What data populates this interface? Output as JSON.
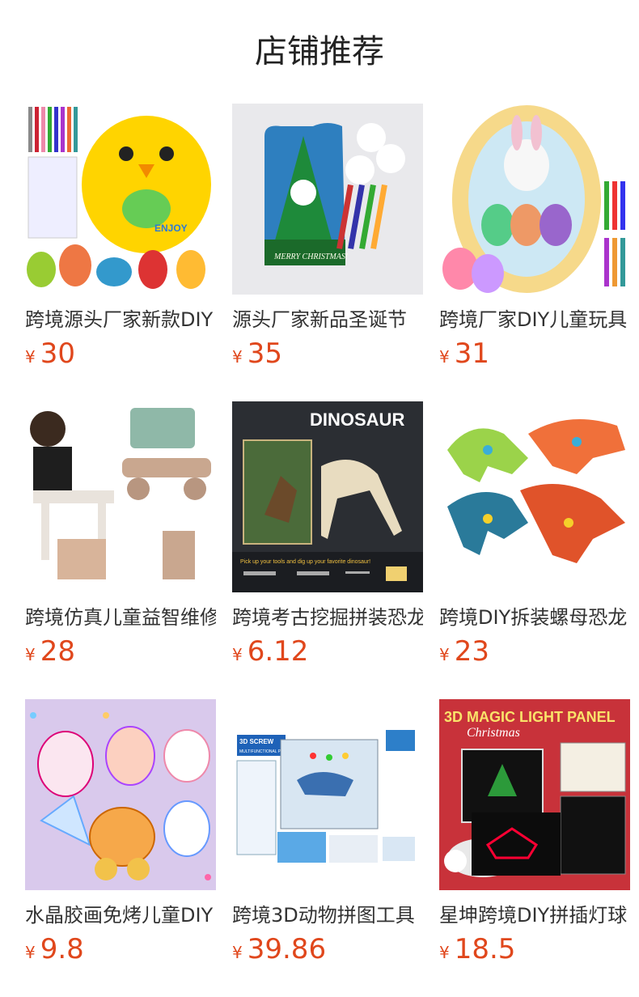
{
  "section": {
    "title": "店铺推荐"
  },
  "products": [
    {
      "name": "跨境源头厂家新款DIY",
      "currency": "¥",
      "price": "30",
      "image_label": "ENJOY",
      "image_sublabel": ""
    },
    {
      "name": "源头厂家新品圣诞节",
      "currency": "¥",
      "price": "35",
      "image_label": "MERRY CHRISTMAS!",
      "image_sublabel": ""
    },
    {
      "name": "跨境厂家DIY儿童玩具",
      "currency": "¥",
      "price": "31",
      "image_label": "",
      "image_sublabel": ""
    },
    {
      "name": "跨境仿真儿童益智维修",
      "currency": "¥",
      "price": "28",
      "image_label": "",
      "image_sublabel": ""
    },
    {
      "name": "跨境考古挖掘拼装恐龙",
      "currency": "¥",
      "price": "6.12",
      "image_label": "DINOSAUR",
      "image_sublabel": "Pick up your tools and dig up your favorite dinosaur!"
    },
    {
      "name": "跨境DIY拆装螺母恐龙",
      "currency": "¥",
      "price": "23",
      "image_label": "",
      "image_sublabel": ""
    },
    {
      "name": "水晶胶画免烤儿童DIY",
      "currency": "¥",
      "price": "9.8",
      "image_label": "",
      "image_sublabel": ""
    },
    {
      "name": "跨境3D动物拼图工具",
      "currency": "¥",
      "price": "39.86",
      "image_label": "3D SCREW",
      "image_sublabel": "MULTIFUNCTIONAL PUZZLE BOX"
    },
    {
      "name": "星坤跨境DIY拼插灯球",
      "currency": "¥",
      "price": "18.5",
      "image_label": "3D MAGIC LIGHT PANEL",
      "image_sublabel": "Christmas"
    }
  ],
  "colors": {
    "price": "#e0471c",
    "title": "#222222",
    "text": "#333333"
  }
}
